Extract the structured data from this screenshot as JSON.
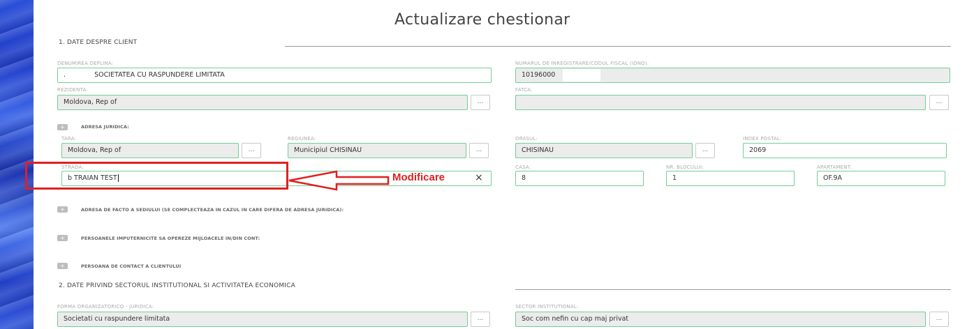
{
  "page": {
    "title": "Actualizare chestionar"
  },
  "sections": {
    "s1": "1. DATE DESPRE CLIENT",
    "s2": "2. DATE PRIVIND SECTORUL INSTITUTIONAL SI ACTIVITATEA ECONOMICA"
  },
  "client": {
    "denumirea_label": "DENUMIREA DEPLINA:",
    "denumirea_value": "SOCIETATEA CU RASPUNDERE LIMITATA",
    "denumirea_prefix": ".",
    "idno_label": "NUMARUL DE INREGISTRARE/CODUL FISCAL (IDNO):",
    "idno_value": "10196000",
    "rezidenta_label": "REZIDENTA:",
    "rezidenta_value": "Moldova, Rep of",
    "fatca_label": "FATCA:",
    "fatca_value": ""
  },
  "adresa_juridica": {
    "header": "ADRESA JURIDICA:",
    "tara_label": "TARA:",
    "tara_value": "Moldova, Rep of",
    "regiunea_label": "REGIUNEA:",
    "regiunea_value": "Municipiul CHISINAU",
    "orasul_label": "ORASUL:",
    "orasul_value": "CHISINAU",
    "index_label": "INDEX POSTAL:",
    "index_value": "2069",
    "strada_label": "STRADA:",
    "strada_value": "b TRAIAN TEST",
    "casa_label": "CASA:",
    "casa_value": "8",
    "bloc_label": "NR. BLOCULUI:",
    "bloc_value": "1",
    "apart_label": "APARTAMENT:",
    "apart_value": "OF.9A"
  },
  "annotation": {
    "text": "Modificare"
  },
  "collapsed_groups": [
    "ADRESA DE FACTO A SEDIULUI (SE COMPLECTEAZA IN CAZUL IN CARE DIFERA DE ADRESA JURIDICA):",
    "PERSOANELE IMPUTERNICITE SA OPEREZE MIJLOACELE IN/DIN CONT:",
    "PERSOANA DE CONTACT A CLIENTULUI"
  ],
  "sector": {
    "forma_label": "FORMA ORGANIZATORICO - JURIDICA:",
    "forma_value": "Societati cu raspundere limitata",
    "sector_label": "SECTOR INSTITUTIONAL:",
    "sector_value": "Soc com nefin cu cap maj privat"
  },
  "icons": {
    "lookup": "...",
    "clear": "×",
    "expand": "+"
  },
  "colors": {
    "field_border": "#6fcf97",
    "annotation": "#e02020"
  }
}
